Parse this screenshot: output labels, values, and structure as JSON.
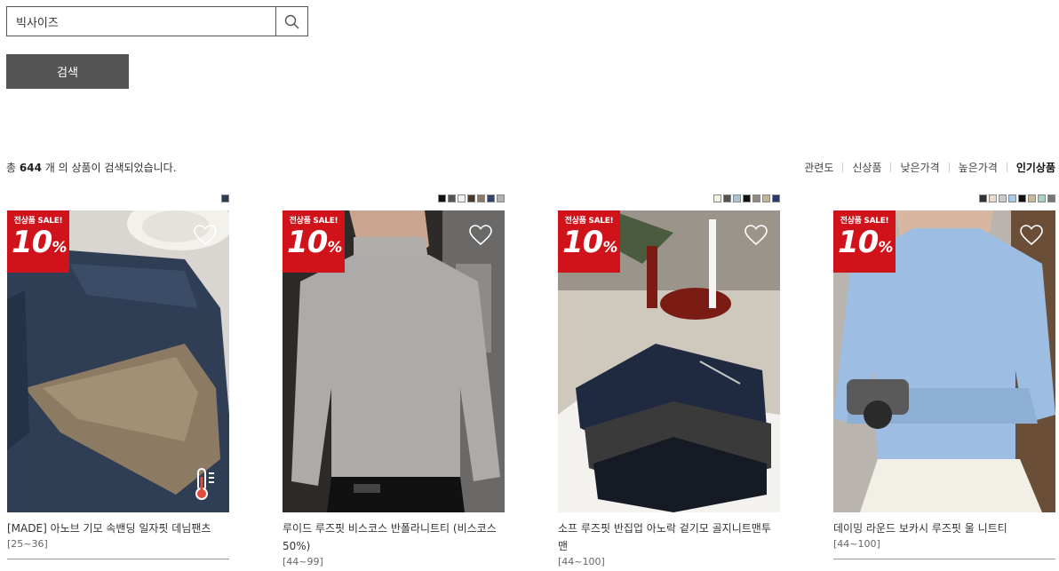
{
  "search": {
    "value": "빅사이즈",
    "button_label": "검색"
  },
  "result": {
    "prefix": "총",
    "count": "644",
    "suffix": "개 의 상품이 검색되었습니다."
  },
  "sort": [
    {
      "label": "관련도",
      "active": false
    },
    {
      "label": "신상품",
      "active": false
    },
    {
      "label": "낮은가격",
      "active": false
    },
    {
      "label": "높은가격",
      "active": false
    },
    {
      "label": "인기상품",
      "active": true
    }
  ],
  "badge": {
    "top": "전상품 SALE!",
    "percent": "10",
    "unit": "%"
  },
  "products": [
    {
      "title": "[MADE] 아노브 기모 속밴딩 일자핏 데님팬츠",
      "size": "[25~36]",
      "swatches": [
        "#2e3b55"
      ],
      "has_thermo_icon": true
    },
    {
      "title": "루이드 루즈핏 비스코스 반폴라니트티 (비스코스50%)",
      "size": "[44~99]",
      "swatches": [
        "#111111",
        "#555555",
        "#f2f0ea",
        "#4a382e",
        "#8a7a6a",
        "#33416f",
        "#b0b0b0"
      ],
      "has_thermo_icon": false
    },
    {
      "title": "소프 루즈핏 반집업 아노락 겉기모 골지니트맨투맨",
      "size": "[44~100]",
      "swatches": [
        "#f4efe3",
        "#555555",
        "#a9c4d6",
        "#111111",
        "#8b8b82",
        "#c0b59a",
        "#2b3a6a"
      ],
      "has_thermo_icon": false
    },
    {
      "title": "데이밍 라운드 보카시 루즈핏 울 니트티",
      "size": "[44~100]",
      "swatches": [
        "#333333",
        "#e8dcc6",
        "#c9c9c9",
        "#a9c8e6",
        "#111111",
        "#c8b89a",
        "#a7d2c0",
        "#777777"
      ],
      "has_thermo_icon": false
    }
  ],
  "colors": {
    "sale_red": "#d0121b",
    "button_bg": "#555555"
  }
}
